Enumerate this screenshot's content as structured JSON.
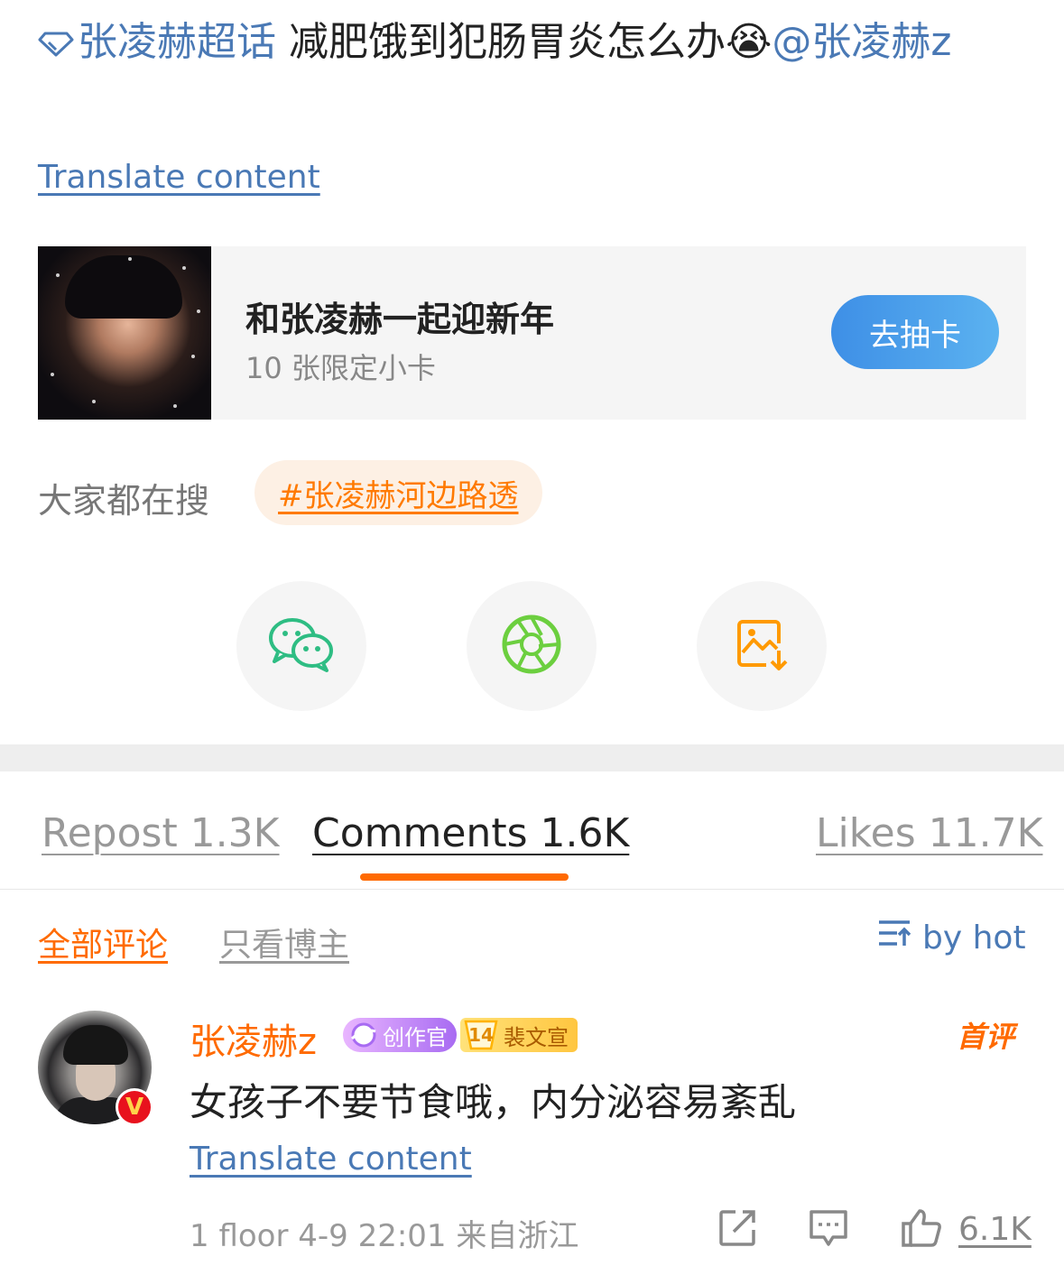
{
  "post": {
    "topic": "张凌赫超话",
    "text": " 减肥饿到犯肠胃炎怎么办",
    "emoji": "😭",
    "mention": "@张凌赫z",
    "translate_label": "Translate content"
  },
  "card": {
    "title": "和张凌赫一起迎新年",
    "subtitle": "10 张限定小卡",
    "button_label": "去抽卡"
  },
  "search": {
    "label": "大家都在搜",
    "tag": "#张凌赫河边路透"
  },
  "share": {
    "icons": [
      "wechat-icon",
      "moments-icon",
      "save-image-icon"
    ]
  },
  "tabs": {
    "repost": "Repost 1.3K",
    "comments": "Comments 1.6K",
    "likes": "Likes 11.7K"
  },
  "filters": {
    "all": "全部评论",
    "author_only": "只看博主",
    "sort": "by hot"
  },
  "comment": {
    "username": "张凌赫z",
    "badge_creator": "创作官",
    "badge_fan_level": "14",
    "badge_fan_name": "裴文宣",
    "first_label": "首评",
    "text": "女孩子不要节食哦，内分泌容易紊乱",
    "translate_label": "Translate content",
    "meta": "1 floor  4-9  22:01  来自浙江",
    "likes": "6.1K",
    "v_badge": "V"
  },
  "colors": {
    "link": "#4a79b5",
    "accent_orange": "#ff6a00",
    "button_blue": "#3e8fe6",
    "wechat_green": "#2ebd83",
    "moments_green": "#6ccf3f",
    "save_orange": "#ff9a00"
  }
}
